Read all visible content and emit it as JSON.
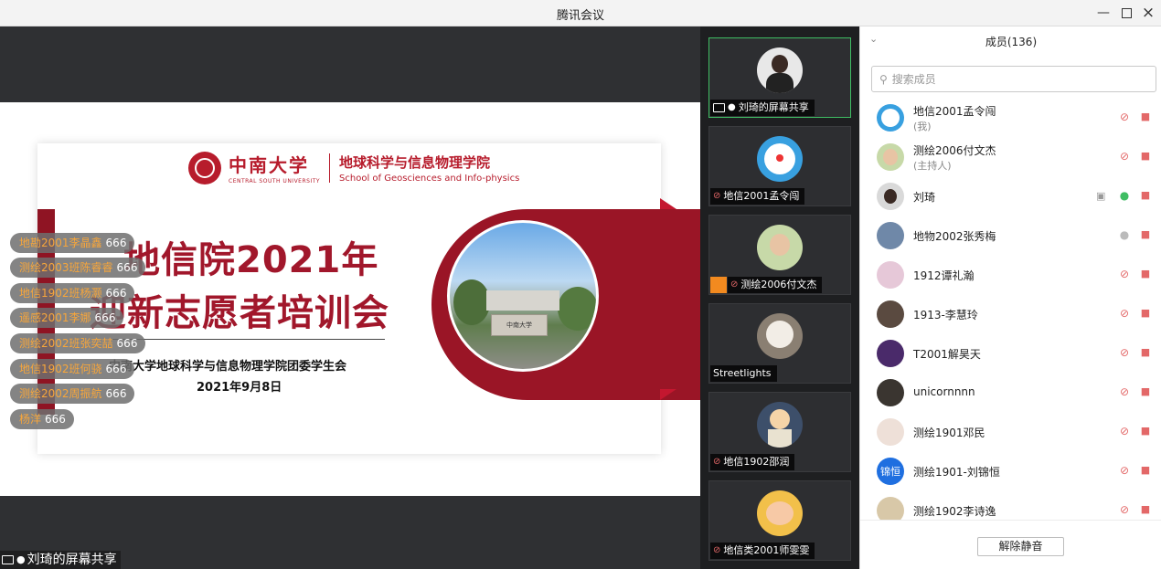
{
  "window": {
    "title": "腾讯会议",
    "controls": [
      "minimize",
      "maximize",
      "close"
    ]
  },
  "slide": {
    "university_cn": "中南大学",
    "university_en": "CENTRAL SOUTH UNIVERSITY",
    "school_cn": "地球科学与信息物理学院",
    "school_en": "School of Geosciences and Info-physics",
    "title_line1": "地信院2021年",
    "title_line2": "迎新志愿者培训会",
    "subtitle": "中南大学地球科学与信息物理学院团委学生会",
    "date": "2021年9月8日",
    "photo_caption": "中南大学",
    "accent_color": "#a1172b"
  },
  "chat": [
    {
      "name": "地勘2001李晶鑫",
      "msg": "666"
    },
    {
      "name": "测绘2003班陈睿睿",
      "msg": "666"
    },
    {
      "name": "地信1902班杨灏",
      "msg": "666"
    },
    {
      "name": "遥感2001李娜",
      "msg": "666"
    },
    {
      "name": "测绘2002班张奕喆",
      "msg": "666"
    },
    {
      "name": "地信1902班何骁",
      "msg": "666"
    },
    {
      "name": "测绘2002周振航",
      "msg": "666"
    },
    {
      "name": "杨洋",
      "msg": "666"
    }
  ],
  "share_label": "刘琦的屏幕共享",
  "video_tiles": [
    {
      "name": "刘琦的屏幕共享",
      "active": true
    },
    {
      "name": "地信2001孟令闯",
      "active": false
    },
    {
      "name": "测绘2006付文杰",
      "active": false
    },
    {
      "name": "Streetlights",
      "active": false
    },
    {
      "name": "地信1902邵润",
      "active": false
    },
    {
      "name": "地信类2001师雯雯",
      "active": false
    }
  ],
  "members": {
    "title": "成员(136)",
    "search_placeholder": "搜索成员",
    "list": [
      {
        "name": "地信2001孟令闯",
        "sub": "(我)",
        "mic": "muted"
      },
      {
        "name": "测绘2006付文杰",
        "sub": "(主持人)",
        "mic": "muted"
      },
      {
        "name": "刘琦",
        "sub": "",
        "mic": "on"
      },
      {
        "name": "地物2002张秀梅",
        "sub": "",
        "mic": "idle"
      },
      {
        "name": "1912谭礼瀚",
        "sub": "",
        "mic": "muted"
      },
      {
        "name": "1913-李慧玲",
        "sub": "",
        "mic": "muted"
      },
      {
        "name": "T2001解昊天",
        "sub": "",
        "mic": "muted"
      },
      {
        "name": "unicornnnn",
        "sub": "",
        "mic": "muted"
      },
      {
        "name": "测绘1901邓民",
        "sub": "",
        "mic": "muted"
      },
      {
        "name": "测绘1901-刘锦恒",
        "sub": "",
        "mic": "muted",
        "avatar_text": "锦恒"
      },
      {
        "name": "测绘1902李诗逸",
        "sub": "",
        "mic": "muted"
      }
    ],
    "unmute_label": "解除静音"
  }
}
